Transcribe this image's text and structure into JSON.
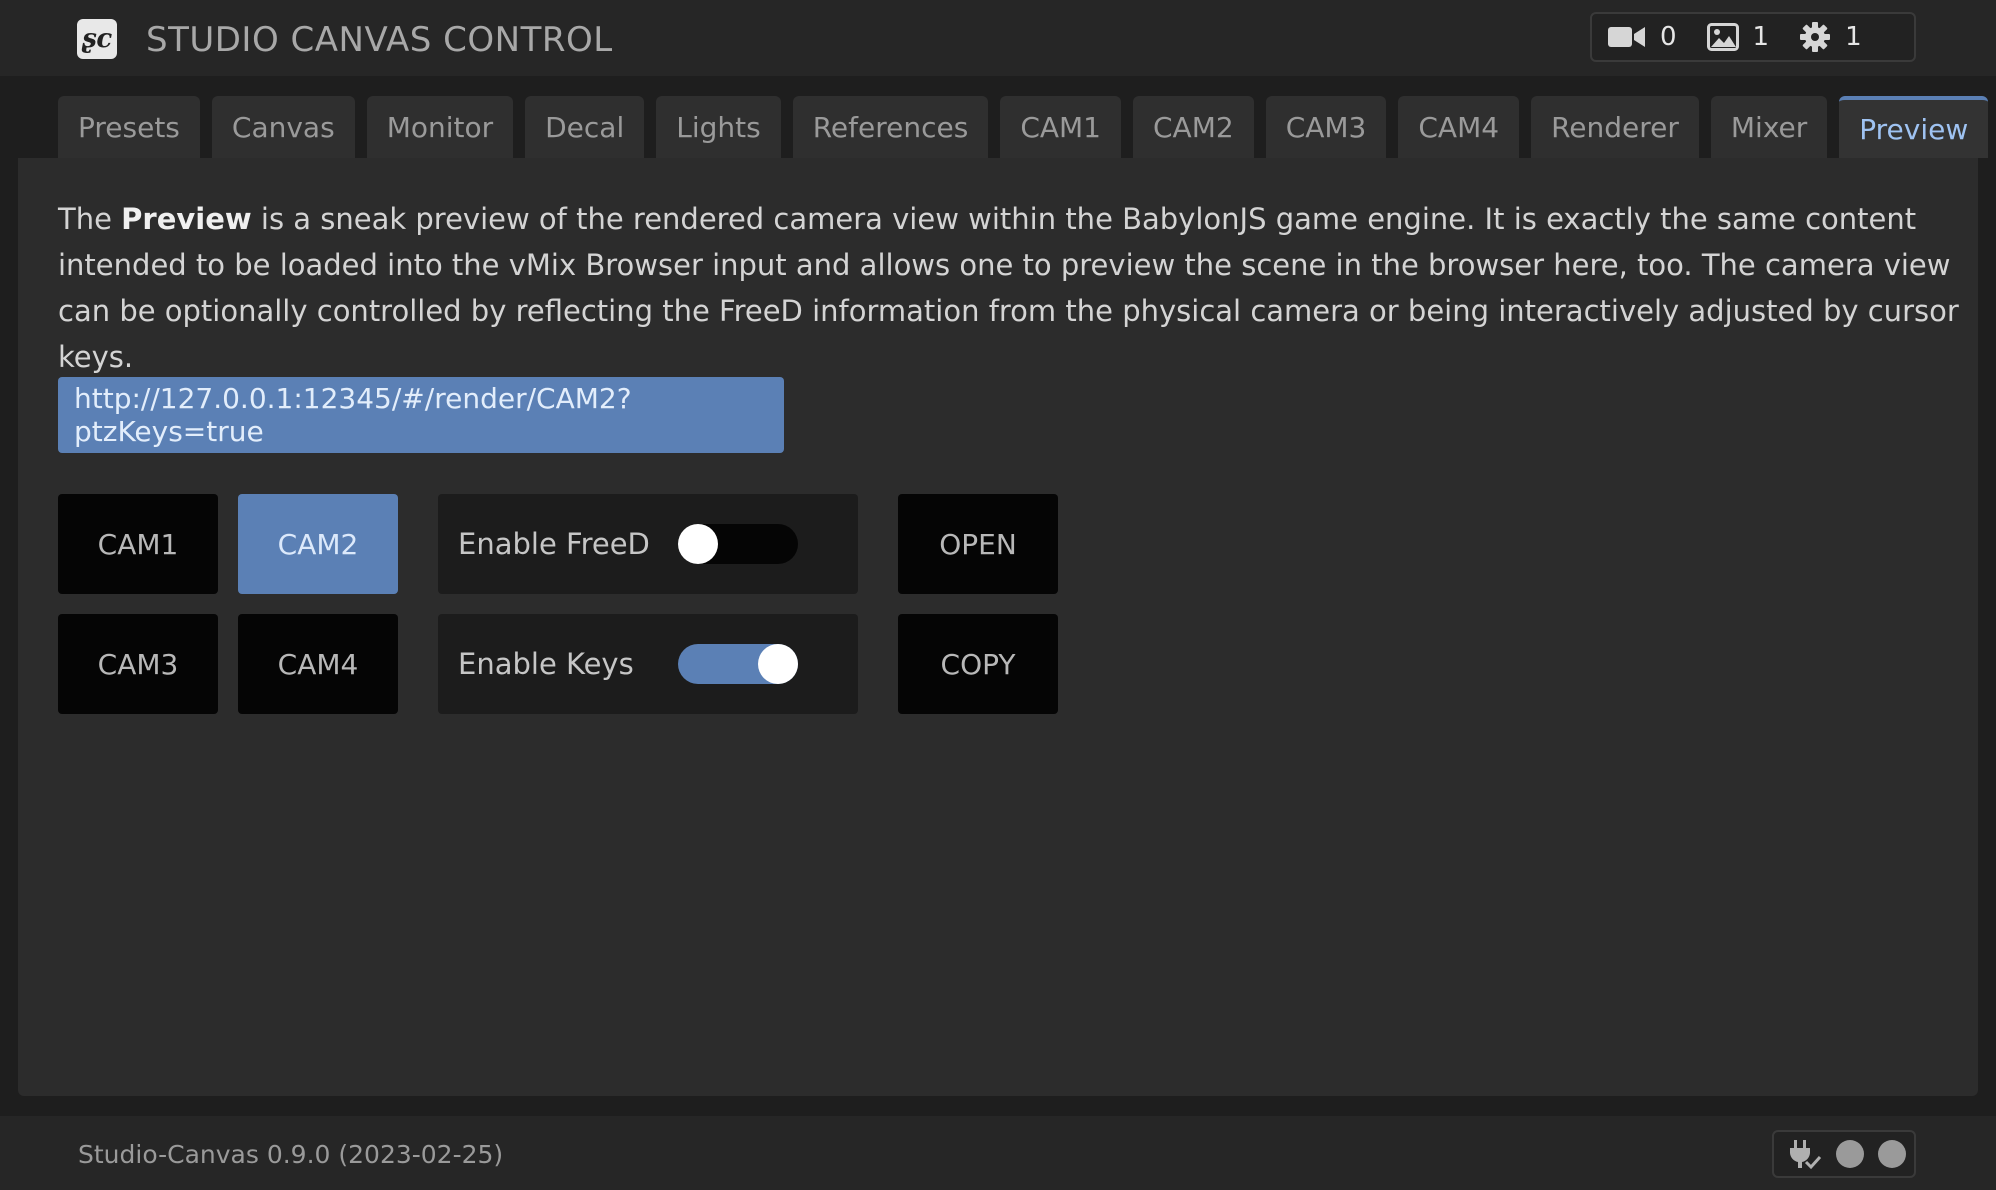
{
  "app": {
    "title": "STUDIO CANVAS CONTROL",
    "logo_text": "ʂc"
  },
  "header_stats": [
    {
      "icon": "video-camera-icon",
      "value": "0"
    },
    {
      "icon": "image-icon",
      "value": "1"
    },
    {
      "icon": "gear-icon",
      "value": "1"
    }
  ],
  "tabs": [
    {
      "label": "Presets"
    },
    {
      "label": "Canvas"
    },
    {
      "label": "Monitor"
    },
    {
      "label": "Decal"
    },
    {
      "label": "Lights"
    },
    {
      "label": "References"
    },
    {
      "label": "CAM1"
    },
    {
      "label": "CAM2"
    },
    {
      "label": "CAM3"
    },
    {
      "label": "CAM4"
    },
    {
      "label": "Renderer"
    },
    {
      "label": "Mixer"
    },
    {
      "label": "Preview",
      "active": true
    }
  ],
  "preview": {
    "desc_before": "The ",
    "desc_bold": "Preview",
    "desc_after": " is a sneak preview of the rendered camera view within the BabylonJS game engine. It is exactly the same content intended to be loaded into the vMix Browser input and allows one to preview the scene in the browser here, too. The camera view can be optionally controlled by reflecting the FreeD information from the physical camera or being interactively adjusted by cursor keys.",
    "url": "http://127.0.0.1:12345/#/render/CAM2?ptzKeys=true",
    "cameras": [
      {
        "label": "CAM1",
        "selected": false
      },
      {
        "label": "CAM2",
        "selected": true
      },
      {
        "label": "CAM3",
        "selected": false
      },
      {
        "label": "CAM4",
        "selected": false
      }
    ],
    "toggles": [
      {
        "label": "Enable FreeD",
        "on": false
      },
      {
        "label": "Enable Keys",
        "on": true
      }
    ],
    "open_label": "OPEN",
    "copy_label": "COPY"
  },
  "footer": {
    "version": "Studio-Canvas 0.9.0 (2023-02-25)",
    "status_icon": "plug-check-icon",
    "status_dots": 2
  },
  "colors": {
    "accent": "#5b80b5",
    "accent_text": "#9fc3f2",
    "background": "#1e1e1e",
    "panel": "#2c2c2c"
  }
}
